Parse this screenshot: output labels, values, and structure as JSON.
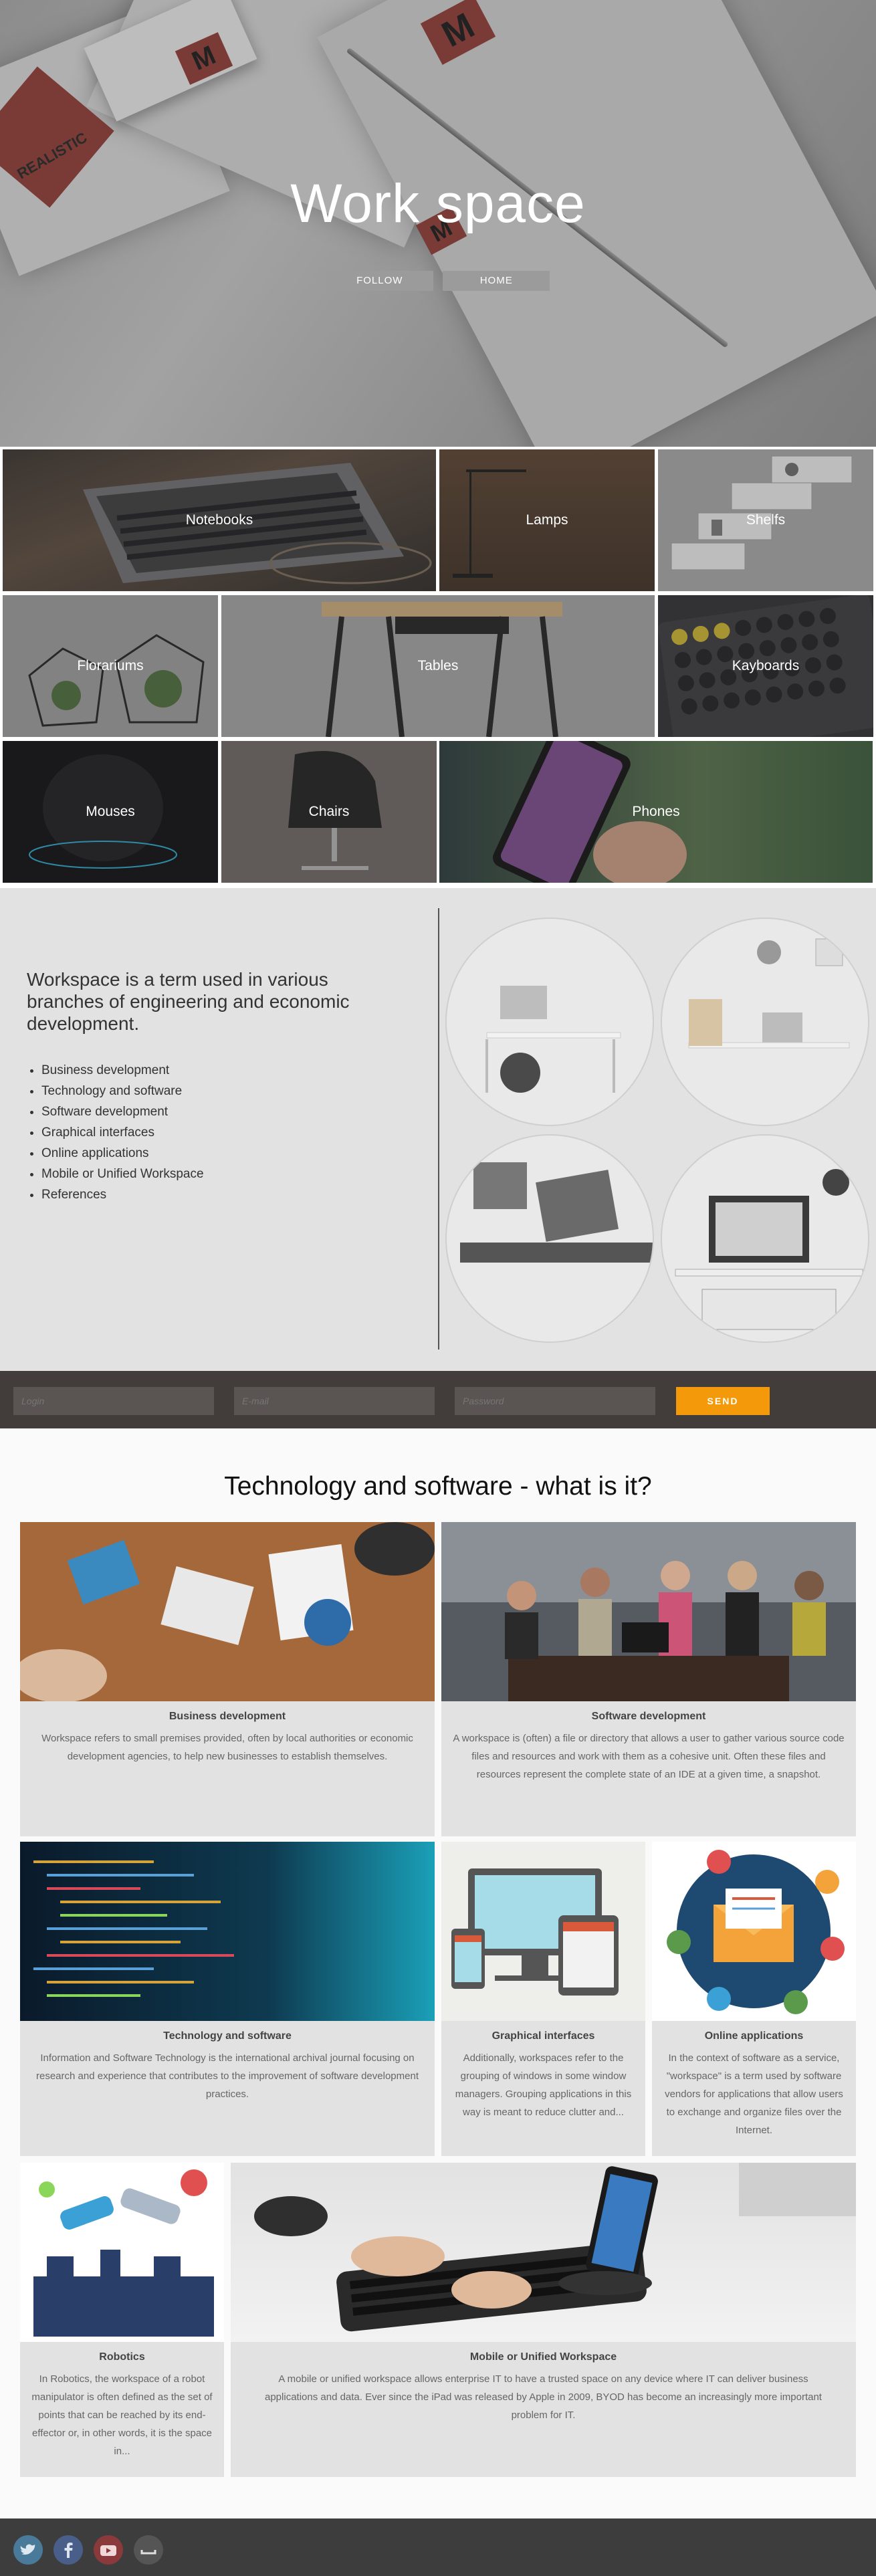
{
  "hero": {
    "title": "Work space",
    "buttons": [
      "FOLLOW",
      "HOME"
    ],
    "brand_tag": "REALISTIC",
    "logo_letter": "M"
  },
  "categories": [
    {
      "label": "Notebooks"
    },
    {
      "label": "Lamps"
    },
    {
      "label": "Shelfs"
    },
    {
      "label": "Florariums"
    },
    {
      "label": "Tables"
    },
    {
      "label": "Kayboards"
    },
    {
      "label": "Mouses"
    },
    {
      "label": "Chairs"
    },
    {
      "label": "Phones"
    }
  ],
  "info": {
    "heading": "Workspace is a term used in various branches of engineering and economic development.",
    "items": [
      "Business development",
      "Technology and software",
      "Software development",
      "Graphical interfaces",
      "Online applications",
      "Mobile or Unified Workspace",
      "References"
    ]
  },
  "form": {
    "login_placeholder": "Login",
    "email_placeholder": "E-mail",
    "password_placeholder": "Password",
    "send_label": "SEND"
  },
  "articles": {
    "title": "Technology and software - what is it?",
    "cards": [
      {
        "title": "Business development",
        "text": "Workspace refers to small premises provided, often by local authorities or economic development agencies, to help new businesses to establish themselves."
      },
      {
        "title": "Software development",
        "text": "A workspace is (often) a file or directory that allows a user to gather various source code files and resources and work with them as a cohesive unit. Often these files and resources represent the complete state of an IDE at a given time, a snapshot."
      },
      {
        "title": "Technology and software",
        "text": "Information and Software Technology is the international archival journal focusing on research and experience that contributes to the improvement of software development practices."
      },
      {
        "title": "Graphical interfaces",
        "text": "Additionally, workspaces refer to the grouping of windows in some window managers. Grouping applications in this way is meant to reduce clutter and..."
      },
      {
        "title": "Online applications",
        "text": "In the context of software as a service, \"workspace\" is a term used by software vendors for applications that allow users to exchange and organize files over the Internet."
      },
      {
        "title": "Robotics",
        "text": "In Robotics, the workspace of a robot manipulator is often defined as the set of points that can be reached by its end-effector or, in other words, it is the space in..."
      },
      {
        "title": "Mobile or Unified Workspace",
        "text": "A mobile or unified workspace allows enterprise IT to have a trusted space on any device where IT can deliver business applications and data. Ever since the iPad was released by Apple in 2009, BYOD has become an increasingly more important problem for IT."
      }
    ]
  },
  "footer": {
    "social": [
      {
        "icon": "twitter-icon",
        "color": "#4a7a9a"
      },
      {
        "icon": "facebook-icon",
        "color": "#4a5e8a"
      },
      {
        "icon": "youtube-icon",
        "color": "#8a3a3a"
      },
      {
        "icon": "other-social-icon",
        "color": "#555555"
      }
    ]
  },
  "colors": {
    "accent": "#f49a0a",
    "form_bg": "#423d3a",
    "footer_bg": "#3d3d3d"
  }
}
